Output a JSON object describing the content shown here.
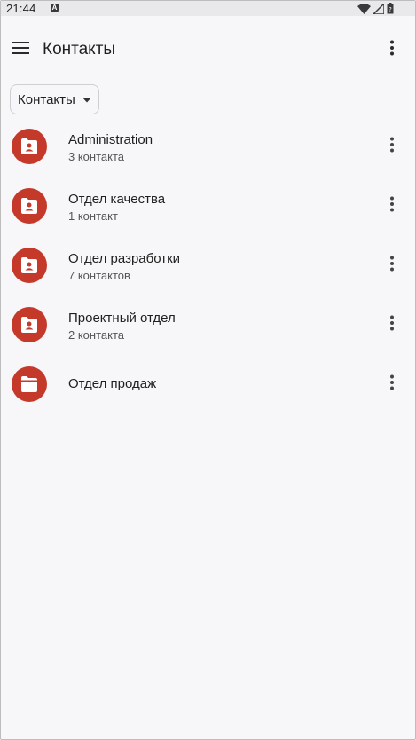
{
  "status_bar": {
    "time": "21:44",
    "notification_icon": "A",
    "icons": [
      "wifi-icon",
      "signal-icon",
      "battery-icon"
    ]
  },
  "toolbar": {
    "menu_icon": "hamburger-menu-icon",
    "title": "Контакты",
    "overflow_icon": "more-vert-icon"
  },
  "filter": {
    "selected": "Контакты"
  },
  "colors": {
    "accent": "#c5392b",
    "background": "#f7f7f9"
  },
  "groups": [
    {
      "name": "Administration",
      "count": "3 контакта",
      "icon": "folder-user-icon"
    },
    {
      "name": "Отдел качества",
      "count": "1 контакт",
      "icon": "folder-user-icon"
    },
    {
      "name": "Отдел разработки",
      "count": "7 контактов",
      "icon": "folder-user-icon"
    },
    {
      "name": "Проектный отдел",
      "count": "2 контакта",
      "icon": "folder-user-icon"
    },
    {
      "name": "Отдел продаж",
      "count": "",
      "icon": "folder-icon"
    }
  ]
}
